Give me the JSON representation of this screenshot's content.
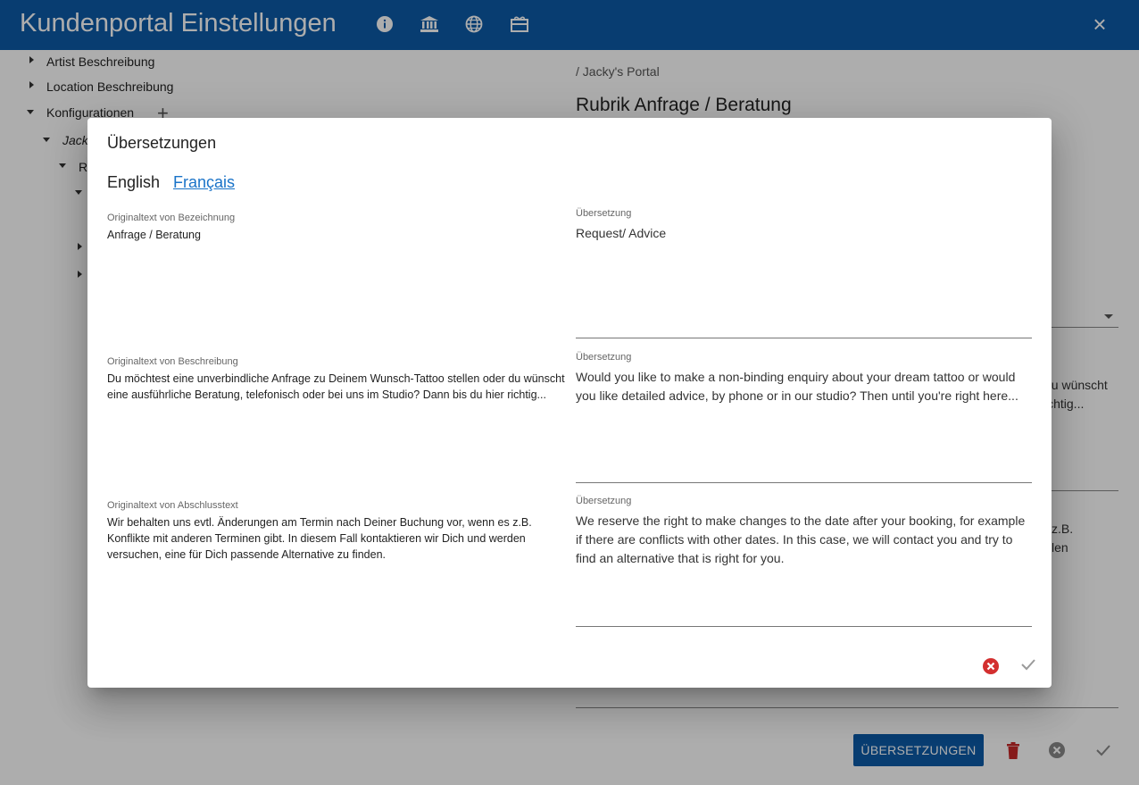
{
  "header": {
    "title": "Kundenportal Einstellungen",
    "icons": [
      "info-icon",
      "bank-icon",
      "globe-icon",
      "gift-card-icon"
    ],
    "close_label": "×"
  },
  "tree": {
    "items": [
      {
        "label": "Artist Beschreibung"
      },
      {
        "label": "Location Beschreibung"
      },
      {
        "label": "Konfigurationen"
      },
      {
        "label": "Jack"
      },
      {
        "label": "R"
      }
    ],
    "add_label": "+"
  },
  "right": {
    "breadcrumb": "/ Jacky's Portal",
    "title": "Rubrik Anfrage / Beratung",
    "snippet1": "du wünscht\nichtig...",
    "snippet2": "z.B.\nlen",
    "translations_button": "ÜBERSETZUNGEN"
  },
  "dialog": {
    "title": "Übersetzungen",
    "tabs": [
      {
        "label": "English",
        "active": true
      },
      {
        "label": "Français",
        "active": false
      }
    ],
    "fields": [
      {
        "original_label": "Originaltext von Bezeichnung",
        "original_text": "Anfrage / Beratung",
        "translation_label": "Übersetzung",
        "translation_text": "Request/ Advice"
      },
      {
        "original_label": "Originaltext von Beschreibung",
        "original_text": "Du möchtest eine unverbindliche Anfrage zu Deinem Wunsch-Tattoo stellen oder du wünscht eine ausführliche Beratung, telefonisch oder bei uns im Studio? Dann bis du hier richtig...",
        "translation_label": "Übersetzung",
        "translation_text": "Would you like to make a non-binding enquiry about your dream tattoo or would you like detailed advice, by phone or in our studio? Then until you're right here..."
      },
      {
        "original_label": "Originaltext von Abschlusstext",
        "original_text": "Wir behalten uns evtl. Änderungen am Termin nach Deiner Buchung vor, wenn es z.B. Konflikte mit anderen Terminen gibt. In diesem Fall kontaktieren wir Dich und werden versuchen, eine für Dich passende Alternative zu finden.",
        "translation_label": "Übersetzung",
        "translation_text": "We reserve the right to make changes to the date after your booking, for example if there are conflicts with other dates. In this case, we will contact you and try to find an alternative that is right for you."
      }
    ]
  },
  "colors": {
    "header_bg": "#0d5aa7",
    "link": "#1a73c8",
    "cancel_red": "#d32f2f"
  }
}
